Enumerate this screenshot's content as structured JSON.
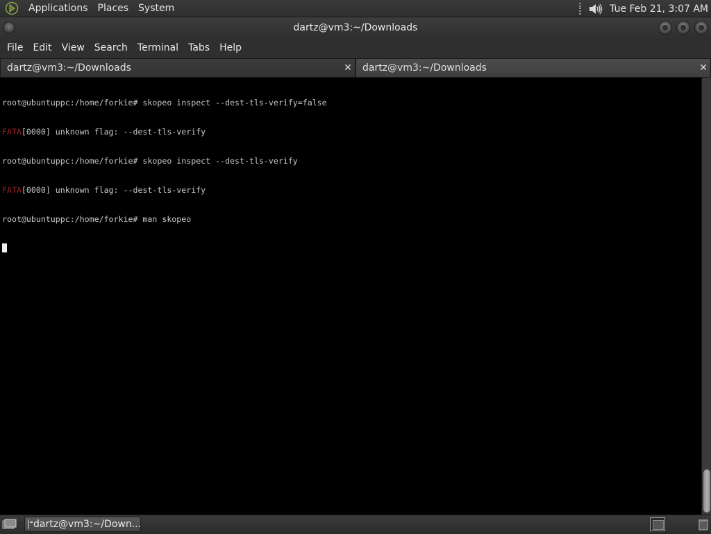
{
  "top_panel": {
    "menus": [
      "Applications",
      "Places",
      "System"
    ],
    "clock": "Tue Feb 21,  3:07 AM",
    "icons": [
      "gnome-foot-icon",
      "volume-icon"
    ]
  },
  "window": {
    "title": "dartz@vm3:~/Downloads"
  },
  "menubar": {
    "items": [
      "File",
      "Edit",
      "View",
      "Search",
      "Terminal",
      "Tabs",
      "Help"
    ]
  },
  "tabs": [
    {
      "label": "dartz@vm3:~/Downloads",
      "active": true
    },
    {
      "label": "dartz@vm3:~/Downloads",
      "active": false
    }
  ],
  "terminal": {
    "lines": [
      {
        "prefix": "",
        "text": "root@ubuntuppc:/home/forkie# skopeo inspect --dest-tls-verify=false"
      },
      {
        "prefix": "FATA",
        "text": "[0000] unknown flag: --dest-tls-verify"
      },
      {
        "prefix": "",
        "text": "root@ubuntuppc:/home/forkie# skopeo inspect --dest-tls-verify"
      },
      {
        "prefix": "FATA",
        "text": "[0000] unknown flag: --dest-tls-verify"
      },
      {
        "prefix": "",
        "text": "root@ubuntuppc:/home/forkie# man skopeo"
      }
    ],
    "colors": {
      "background": "#000000",
      "foreground": "#c8c8c8",
      "error": "#9c1f1f"
    }
  },
  "taskbar": {
    "task_label": "dartz@vm3:~/Down..."
  }
}
